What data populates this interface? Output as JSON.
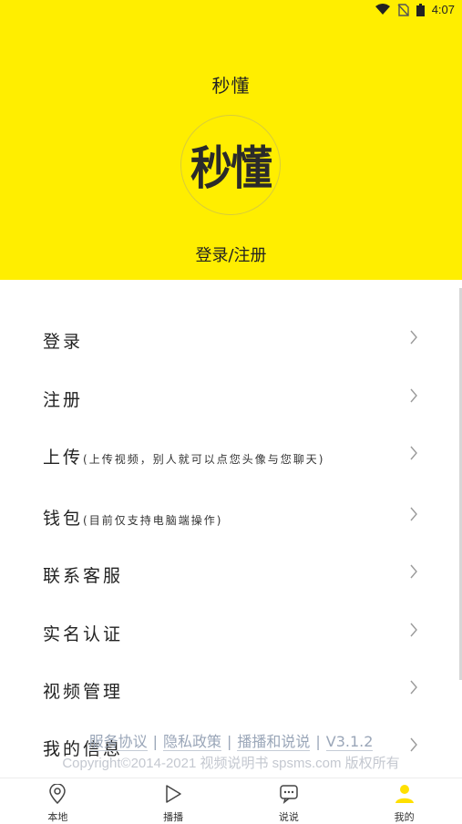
{
  "status_bar": {
    "time": "4:07"
  },
  "header": {
    "title": "秒懂",
    "logo_text": "秒懂",
    "login_label": "登录/注册",
    "bg_color": "#ffee00"
  },
  "menu": {
    "items": [
      {
        "label": "登录",
        "note": ""
      },
      {
        "label": "注册",
        "note": ""
      },
      {
        "label": "上传",
        "note": "(上传视频，别人就可以点您头像与您聊天)"
      },
      {
        "label": "钱包",
        "note": "(目前仅支持电脑端操作)"
      },
      {
        "label": "联系客服",
        "note": ""
      },
      {
        "label": "实名认证",
        "note": ""
      },
      {
        "label": "视频管理",
        "note": ""
      },
      {
        "label": "我的信息",
        "note": ""
      }
    ]
  },
  "footer": {
    "links": [
      "服务协议",
      "隐私政策",
      "播播和说说",
      "V3.1.2"
    ],
    "copyright": "Copyright©2014-2021 视频说明书 spsms.com 版权所有"
  },
  "tabbar": {
    "tabs": [
      {
        "label": "本地",
        "icon": "location-pin-icon"
      },
      {
        "label": "播播",
        "icon": "play-icon"
      },
      {
        "label": "说说",
        "icon": "chat-bubble-icon"
      },
      {
        "label": "我的",
        "icon": "person-icon"
      }
    ],
    "active_color": "#ffe000"
  }
}
